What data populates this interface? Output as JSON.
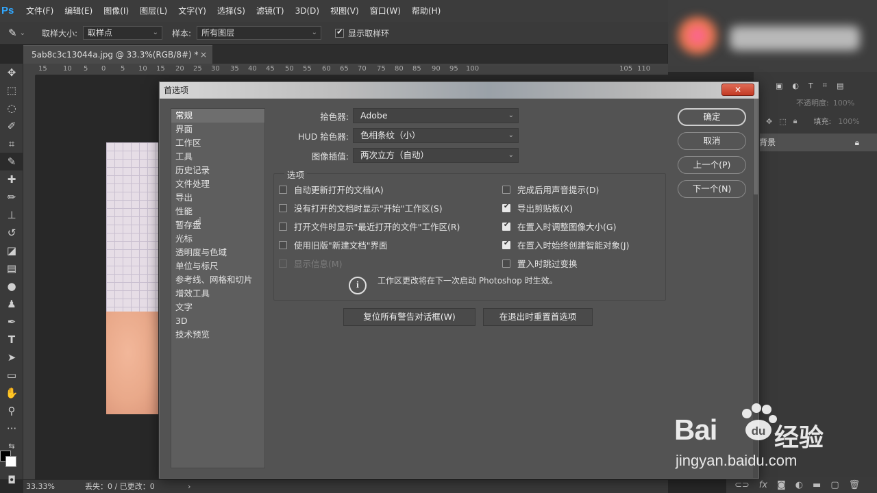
{
  "app": {
    "logo": "Ps"
  },
  "menubar": [
    "文件(F)",
    "编辑(E)",
    "图像(I)",
    "图层(L)",
    "文字(Y)",
    "选择(S)",
    "滤镜(T)",
    "3D(D)",
    "视图(V)",
    "窗口(W)",
    "帮助(H)"
  ],
  "options_bar": {
    "sample_size_label": "取样大小:",
    "sample_size_value": "取样点",
    "sample_label": "样本:",
    "sample_value": "所有图层",
    "show_ring_label": "显示取样环",
    "show_ring_checked": true
  },
  "document": {
    "tab_title": "5ab8c3c13044a.jpg @ 33.3%(RGB/8#) *",
    "close": "×",
    "ruler_ticks": [
      "15",
      "10",
      "5",
      "0",
      "5",
      "10",
      "15",
      "20",
      "25",
      "30",
      "35",
      "40",
      "45",
      "50",
      "55",
      "60",
      "65",
      "70",
      "75",
      "80",
      "85",
      "90",
      "95",
      "100",
      "105",
      "110"
    ],
    "zoom": "33.33%",
    "status": "丢失：0 / 已更改：0",
    "status_arrow": "›"
  },
  "panels": {
    "opacity_label": "不透明度:",
    "opacity_value": "100%",
    "fill_label": "填充:",
    "fill_value": "100%",
    "layer_name": "背景"
  },
  "dialog": {
    "title": "首选项",
    "close": "✕",
    "categories": [
      "常规",
      "界面",
      "工作区",
      "工具",
      "历史记录",
      "文件处理",
      "导出",
      "性能",
      "暂存盘",
      "光标",
      "透明度与色域",
      "单位与标尺",
      "参考线、网格和切片",
      "增效工具",
      "文字",
      "3D",
      "技术预览"
    ],
    "active_category": "常规",
    "fields": {
      "color_picker_label": "拾色器:",
      "color_picker_value": "Adobe",
      "hud_label": "HUD 拾色器:",
      "hud_value": "色相条纹（小）",
      "interp_label": "图像插值:",
      "interp_value": "两次立方（自动）"
    },
    "options_legend": "选项",
    "options_left": [
      {
        "label": "自动更新打开的文档(A)",
        "checked": false,
        "disabled": false
      },
      {
        "label": "没有打开的文档时显示\"开始\"工作区(S)",
        "checked": false,
        "disabled": false
      },
      {
        "label": "打开文件时显示\"最近打开的文件\"工作区(R)",
        "checked": false,
        "disabled": false
      },
      {
        "label": "使用旧版\"新建文档\"界面",
        "checked": false,
        "disabled": false
      },
      {
        "label": "显示信息(M)",
        "checked": false,
        "disabled": true
      }
    ],
    "options_right": [
      {
        "label": "完成后用声音提示(D)",
        "checked": false
      },
      {
        "label": "导出剪贴板(X)",
        "checked": true
      },
      {
        "label": "在置入时调整图像大小(G)",
        "checked": true
      },
      {
        "label": "在置入时始终创建智能对象(J)",
        "checked": true
      },
      {
        "label": "置入时跳过变换",
        "checked": false
      }
    ],
    "info_icon": "i",
    "info_text": "工作区更改将在下一次启动 Photoshop 时生效。",
    "reset_warnings": "复位所有警告对话框(W)",
    "reset_prefs": "在退出时重置首选项",
    "ok": "确定",
    "cancel": "取消",
    "prev": "上一个(P)",
    "next": "下一个(N)"
  },
  "watermark": {
    "logo": "Bai",
    "logo_du": "du",
    "brand": "经验",
    "url": "jingyan.baidu.com"
  },
  "colors": {
    "accent": "#31a8ff",
    "close_red": "#c23a24"
  }
}
